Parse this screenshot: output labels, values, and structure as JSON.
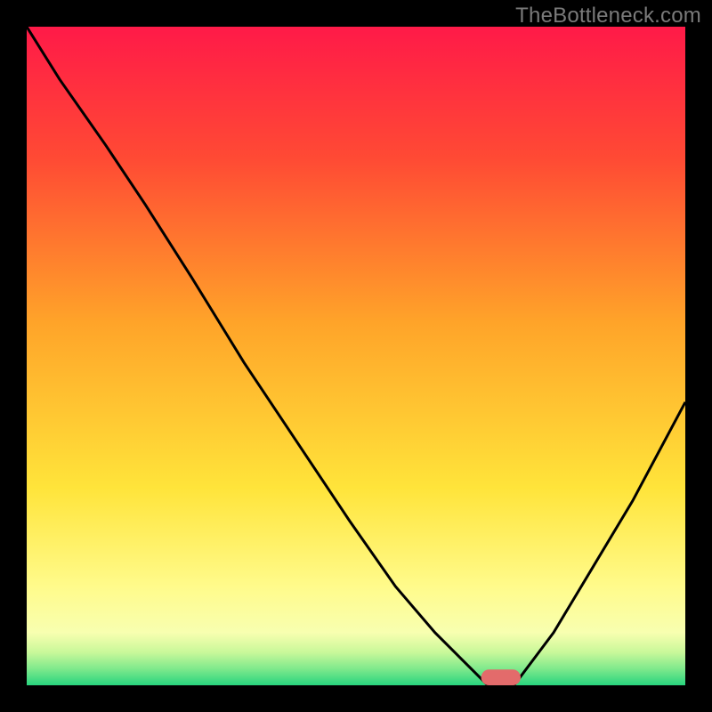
{
  "watermark": "TheBottleneck.com",
  "chart_data": {
    "type": "line",
    "title": "",
    "xlabel": "",
    "ylabel": "",
    "xlim": [
      0,
      100
    ],
    "ylim": [
      0,
      100
    ],
    "grid": false,
    "legend": false,
    "background_gradient": {
      "stops": [
        {
          "pos": 0.0,
          "color": "#ff1a48"
        },
        {
          "pos": 0.2,
          "color": "#ff4a34"
        },
        {
          "pos": 0.45,
          "color": "#ffa429"
        },
        {
          "pos": 0.7,
          "color": "#ffe43a"
        },
        {
          "pos": 0.85,
          "color": "#fffb8b"
        },
        {
          "pos": 0.92,
          "color": "#f8ffb0"
        },
        {
          "pos": 0.95,
          "color": "#c9f89a"
        },
        {
          "pos": 0.975,
          "color": "#7fe98c"
        },
        {
          "pos": 1.0,
          "color": "#28d47e"
        }
      ]
    },
    "series": [
      {
        "name": "curve",
        "color": "#000000",
        "x": [
          0,
          5,
          12,
          18,
          25,
          33,
          41,
          49,
          56,
          62,
          66,
          68,
          70,
          74,
          80,
          86,
          92,
          100
        ],
        "values": [
          100,
          92,
          82,
          73,
          62,
          49,
          37,
          25,
          15,
          8,
          4,
          2,
          0,
          0,
          8,
          18,
          28,
          43
        ]
      }
    ],
    "marker": {
      "name": "highlight-pill",
      "x": 72,
      "y": 1.2,
      "width": 6,
      "height": 2.4,
      "rx": 1.2,
      "color": "#e36b6b"
    }
  }
}
